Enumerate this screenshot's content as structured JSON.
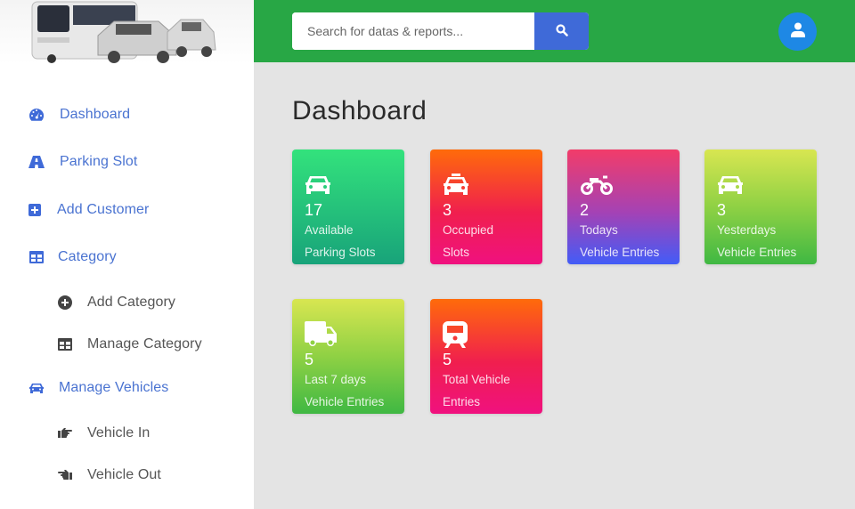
{
  "sidebar": {
    "logo_alt": "Bus and cars logo",
    "items": [
      {
        "label": "Dashboard",
        "icon": "tachometer-icon",
        "level": "main"
      },
      {
        "label": "Parking Slot",
        "icon": "road-icon",
        "level": "main"
      },
      {
        "label": "Add Customer",
        "icon": "plus-square-icon",
        "level": "main"
      },
      {
        "label": "Category",
        "icon": "table-icon",
        "level": "main"
      },
      {
        "label": "Add Category",
        "icon": "plus-circle-icon",
        "level": "sub"
      },
      {
        "label": "Manage Category",
        "icon": "table-icon",
        "level": "sub"
      },
      {
        "label": "Manage Vehicles",
        "icon": "car-icon",
        "level": "main"
      },
      {
        "label": "Vehicle In",
        "icon": "hand-point-right-icon",
        "level": "sub"
      },
      {
        "label": "Vehicle Out",
        "icon": "hand-point-left-icon",
        "level": "sub"
      }
    ]
  },
  "topbar": {
    "search_placeholder": "Search for datas & reports...",
    "search_value": "",
    "search_button_icon": "search-icon",
    "user_icon": "user-icon",
    "accent_color": "#28a745"
  },
  "main": {
    "title": "Dashboard",
    "cards": [
      {
        "icon": "car-icon",
        "value": "17",
        "line1": "Available",
        "line2": "Parking Slots",
        "gradient": "green"
      },
      {
        "icon": "taxi-icon",
        "value": "3",
        "line1": "Occupied",
        "line2": "Slots",
        "gradient": "orange"
      },
      {
        "icon": "motorcycle-icon",
        "value": "2",
        "line1": "Todays",
        "line2": "Vehicle Entries",
        "gradient": "purple"
      },
      {
        "icon": "car-icon",
        "value": "3",
        "line1": "Yesterdays",
        "line2": "Vehicle Entries",
        "gradient": "lime"
      },
      {
        "icon": "truck-icon",
        "value": "5",
        "line1": "Last 7 days",
        "line2": "Vehicle Entries",
        "gradient": "lime"
      },
      {
        "icon": "train-icon",
        "value": "5",
        "line1": "Total Vehicle",
        "line2": "Entries",
        "gradient": "orange"
      }
    ]
  }
}
